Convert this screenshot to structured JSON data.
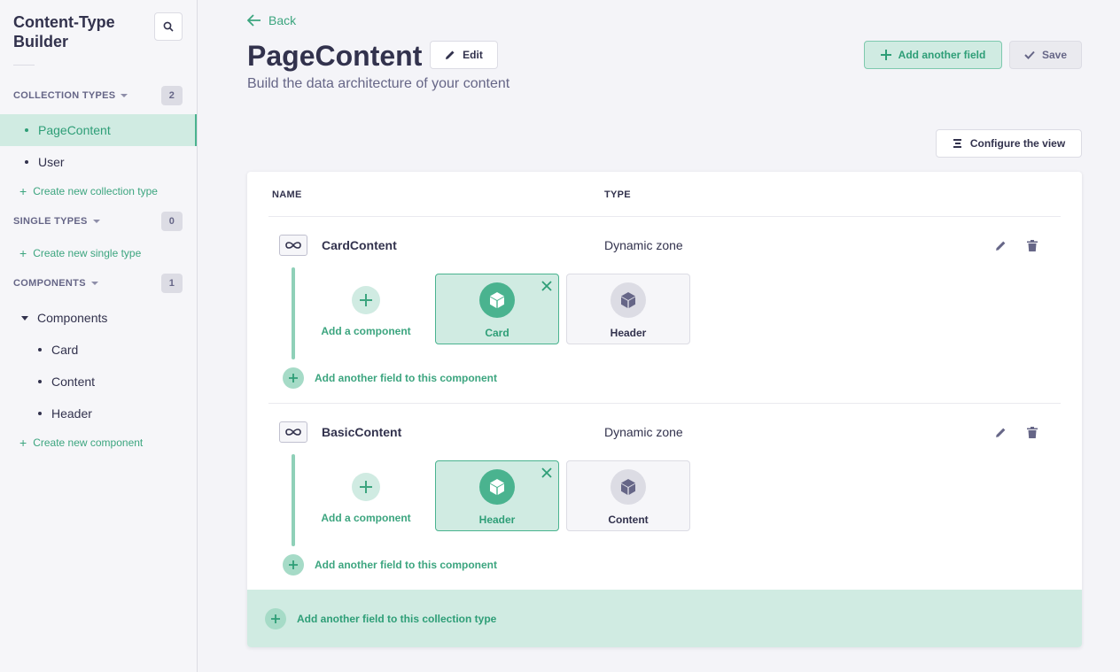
{
  "sidebar": {
    "title": "Content-Type Builder",
    "search_icon": "search-icon",
    "collection_types": {
      "label": "COLLECTION TYPES",
      "count": "2",
      "items": [
        {
          "label": "PageContent",
          "active": true
        },
        {
          "label": "User",
          "active": false
        }
      ],
      "create_label": "Create new collection type"
    },
    "single_types": {
      "label": "SINGLE TYPES",
      "count": "0",
      "create_label": "Create new single type"
    },
    "components": {
      "label": "COMPONENTS",
      "count": "1",
      "group_label": "Components",
      "items": [
        "Card",
        "Content",
        "Header"
      ],
      "create_label": "Create new component"
    }
  },
  "header": {
    "back_label": "Back",
    "title": "PageContent",
    "edit_label": "Edit",
    "subtitle": "Build the data architecture of your content",
    "add_field_label": "Add another field",
    "save_label": "Save",
    "configure_label": "Configure the view"
  },
  "table": {
    "col_name": "NAME",
    "col_type": "TYPE",
    "rows": [
      {
        "name": "CardContent",
        "type": "Dynamic zone",
        "add_component_label": "Add a component",
        "components": [
          {
            "label": "Card",
            "active": true
          },
          {
            "label": "Header",
            "active": false
          }
        ],
        "add_field_label": "Add another field to this component"
      },
      {
        "name": "BasicContent",
        "type": "Dynamic zone",
        "add_component_label": "Add a component",
        "components": [
          {
            "label": "Header",
            "active": true
          },
          {
            "label": "Content",
            "active": false
          }
        ],
        "add_field_label": "Add another field to this component"
      }
    ],
    "footer_add_label": "Add another field to this collection type"
  },
  "colors": {
    "accent": "#4ab38f",
    "accent_light": "#d0ebe2",
    "text": "#32324d"
  }
}
